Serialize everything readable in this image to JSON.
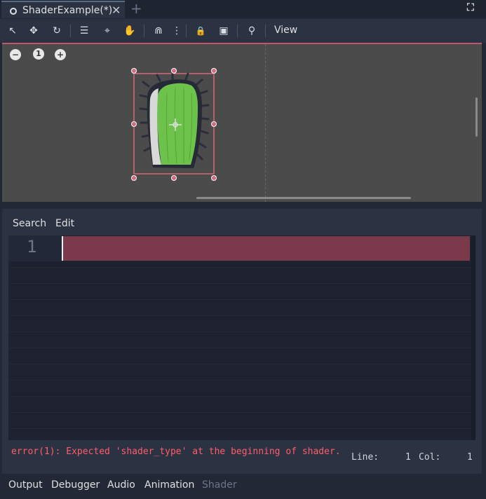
{
  "tabbar": {
    "tab_title": "ShaderExample(*)",
    "close_glyph": "✕",
    "add_glyph": "+",
    "distraction_glyph": "⛶"
  },
  "toolbar": {
    "view_label": "View",
    "tools": [
      {
        "name": "select-mode-icon",
        "glyph": "↖"
      },
      {
        "name": "move-mode-icon",
        "glyph": "✥"
      },
      {
        "name": "rotate-mode-icon",
        "glyph": "↻"
      },
      {
        "name": "list-select-icon",
        "glyph": "☰"
      },
      {
        "name": "pivot-mode-icon",
        "glyph": "⌖"
      },
      {
        "name": "pan-mode-icon",
        "glyph": "✋"
      },
      {
        "name": "snap-icon",
        "glyph": "⋒"
      },
      {
        "name": "more-options-icon",
        "glyph": "⋮"
      },
      {
        "name": "lock-icon",
        "glyph": "🔒"
      },
      {
        "name": "group-icon",
        "glyph": "▣"
      },
      {
        "name": "bone-icon",
        "glyph": "⚲"
      }
    ]
  },
  "viewport": {
    "zoom_out_glyph": "−",
    "zoom_reset_label": "1",
    "zoom_in_glyph": "+"
  },
  "shader_editor": {
    "menu_search": "Search",
    "menu_edit": "Edit",
    "line_number": "1",
    "error_message": "error(1): Expected 'shader_type' at the beginning of shader.",
    "line_label": "Line:",
    "line_value": "1",
    "col_label": "Col:",
    "col_value": "1"
  },
  "bottom_tabs": [
    {
      "label": "Output",
      "enabled": true
    },
    {
      "label": "Debugger",
      "enabled": true
    },
    {
      "label": "Audio",
      "enabled": true
    },
    {
      "label": "Animation",
      "enabled": true
    },
    {
      "label": "Shader",
      "enabled": false
    }
  ],
  "colors": {
    "background": "#222836",
    "panel": "#2b3242",
    "viewport": "#4b4b4b",
    "error_text": "#ff5d6a",
    "error_line": "#7a3a4c",
    "selection_border": "#c2566b",
    "cactus_green": "#6cc24a"
  }
}
